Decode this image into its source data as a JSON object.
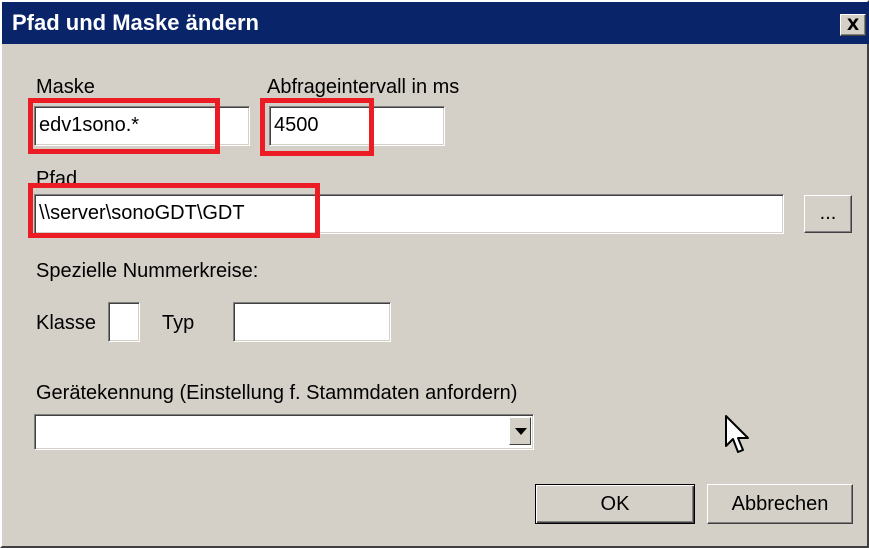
{
  "window": {
    "title": "Pfad und Maske ändern",
    "close_label": "X"
  },
  "mask": {
    "label": "Maske",
    "value": "edv1sono.*"
  },
  "interval": {
    "label": "Abfrageintervall in ms",
    "value": "4500"
  },
  "path": {
    "label": "Pfad",
    "value": "\\\\server\\sonoGDT\\GDT",
    "browse_label": "..."
  },
  "special": {
    "label": "Spezielle Nummerkreise:",
    "class_label": "Klasse",
    "class_value": "",
    "type_label": "Typ",
    "type_value": ""
  },
  "device": {
    "label": "Gerätekennung (Einstellung f. Stammdaten anfordern)",
    "selected": ""
  },
  "buttons": {
    "ok": "OK",
    "cancel": "Abbrechen"
  },
  "colors": {
    "titlebar": "#0a246a",
    "highlight": "#ec1c24",
    "face": "#d4d0c8"
  },
  "cursor": "arrow-cursor-icon"
}
